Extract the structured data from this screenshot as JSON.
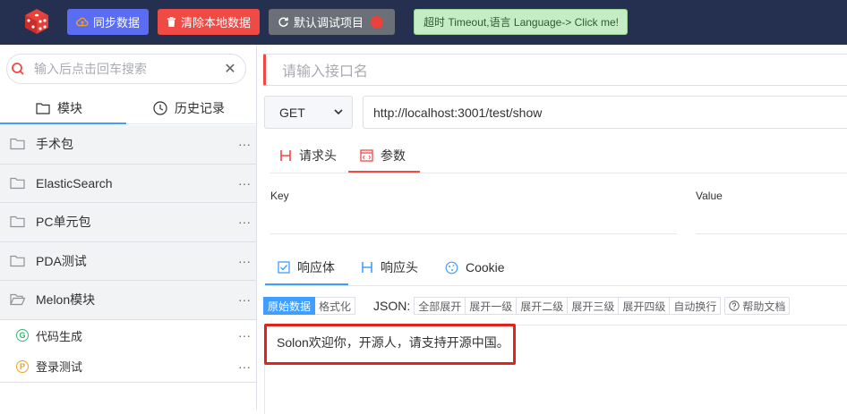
{
  "topbar": {
    "sync_label": "同步数据",
    "clear_label": "清除本地数据",
    "debug_label": "默认调试项目",
    "hint_label": "超时 Timeout,语言 Language-> Click me!"
  },
  "sidebar": {
    "search_placeholder": "输入后点击回车搜索",
    "tabs": {
      "modules": "模块",
      "history": "历史记录"
    },
    "folders": [
      {
        "label": "手术包"
      },
      {
        "label": "ElasticSearch"
      },
      {
        "label": "PC单元包"
      },
      {
        "label": "PDA测试"
      },
      {
        "label": "Melon模块"
      }
    ],
    "apis": [
      {
        "badge": "G",
        "label": "代码生成",
        "color": "#3cb371"
      },
      {
        "badge": "P",
        "label": "登录测试",
        "color": "#f0a020"
      }
    ],
    "more": "···"
  },
  "main": {
    "name_placeholder": "请输入接口名",
    "method": "GET",
    "url": "http://localhost:3001/test/show",
    "request_tabs": {
      "headers": "请求头",
      "params": "参数"
    },
    "params_columns": {
      "key": "Key",
      "value": "Value"
    },
    "response_tabs": {
      "body": "响应体",
      "headers": "响应头",
      "cookie": "Cookie"
    },
    "toolbar": {
      "raw": "原始数据",
      "format": "格式化",
      "json_label": "JSON:",
      "expand_all": "全部展开",
      "expand1": "展开一级",
      "expand2": "展开二级",
      "expand3": "展开三级",
      "expand4": "展开四级",
      "wrap": "自动换行",
      "help": "帮助文档"
    },
    "response_text": "Solon欢迎你，开源人，请支持开源中国。"
  },
  "colors": {
    "topbar": "#253050",
    "accent_blue": "#409eff",
    "accent_red": "#f04a45"
  }
}
